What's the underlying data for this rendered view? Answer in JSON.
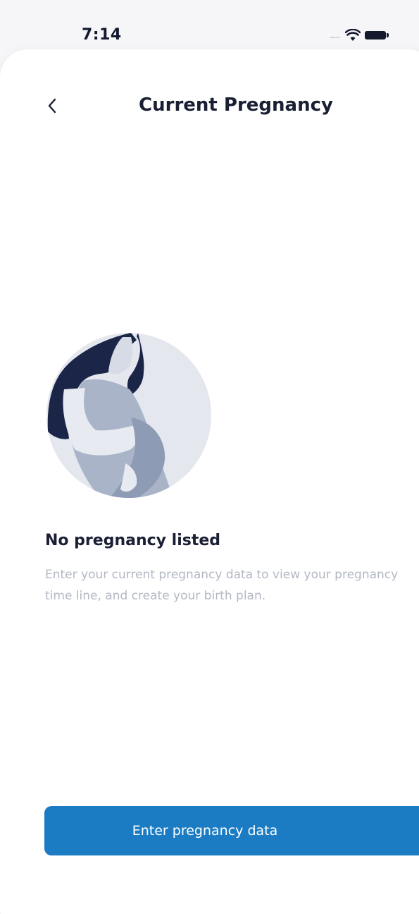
{
  "status_bar": {
    "time": "7:14",
    "signal_dots": "....."
  },
  "header": {
    "title": "Current Pregnancy",
    "back_icon": "chevron-left-icon"
  },
  "empty_state": {
    "illustration": "pregnant-woman-illustration",
    "title": "No pregnancy listed",
    "description": "Enter your current pregnancy data to view your pregnancy time line, and create your birth plan."
  },
  "actions": {
    "enter_data_label": "Enter pregnancy data"
  },
  "colors": {
    "primary": "#1b7cc4",
    "title_text": "#1a1f33",
    "muted_text": "#b3b8c3",
    "illustration_bg": "#e4e7ee",
    "illustration_dark": "#1b2548",
    "illustration_mid": "#9fabc2"
  }
}
